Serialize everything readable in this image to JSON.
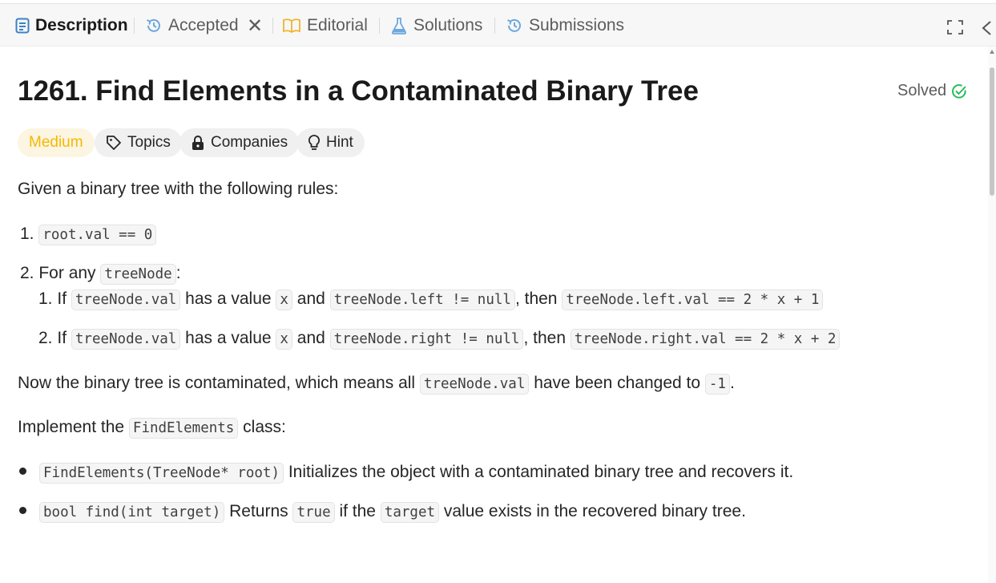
{
  "tabs": {
    "description": "Description",
    "accepted": "Accepted",
    "close": "✕",
    "editorial": "Editorial",
    "solutions": "Solutions",
    "submissions": "Submissions"
  },
  "problem": {
    "title": "1261. Find Elements in a Contaminated Binary Tree",
    "status": "Solved"
  },
  "pills": {
    "difficulty": "Medium",
    "topics": "Topics",
    "companies": "Companies",
    "hint": "Hint"
  },
  "body": {
    "intro": "Given a binary tree with the following rules:",
    "rule1": {
      "num": "1.",
      "code": "root.val == 0"
    },
    "rule2": {
      "num": "2.",
      "pre": "For any ",
      "code": "treeNode",
      "post": ":"
    },
    "sub1": {
      "num": "1.",
      "t1": "If ",
      "c1": "treeNode.val",
      "t2": " has a value ",
      "c2": "x",
      "t3": " and ",
      "c3": "treeNode.left != null",
      "t4": ", then ",
      "c4": "treeNode.left.val == 2 * x + 1"
    },
    "sub2": {
      "num": "2.",
      "t1": "If ",
      "c1": "treeNode.val",
      "t2": " has a value ",
      "c2": "x",
      "t3": " and ",
      "c3": "treeNode.right != null",
      "t4": ", then ",
      "c4": "treeNode.right.val == 2 * x + 2"
    },
    "contam": {
      "t1": "Now the binary tree is contaminated, which means all ",
      "c1": "treeNode.val",
      "t2": " have been changed to ",
      "c2": "-1",
      "t3": "."
    },
    "impl": {
      "t1": "Implement the ",
      "c1": "FindElements",
      "t2": " class:"
    },
    "bullet1": {
      "c1": "FindElements(TreeNode* root)",
      "t1": " Initializes the object with a contaminated binary tree and recovers it."
    },
    "bullet2": {
      "c1": "bool find(int target)",
      "t1": " Returns ",
      "c2": "true",
      "t2": " if the ",
      "c3": "target",
      "t3": " value exists in the recovered binary tree."
    }
  },
  "colors": {
    "accent_blue": "#3b82c4",
    "editorial_icon": "#f0b429",
    "solved_green": "#2cbb5d",
    "medium": "#f6b800"
  },
  "icons": [
    "description-icon",
    "history-icon",
    "book-icon",
    "flask-icon",
    "history-icon",
    "lock-icon",
    "tag-icon",
    "lightbulb-icon",
    "check-circle-icon",
    "fullscreen-icon",
    "chevron-left-icon"
  ]
}
